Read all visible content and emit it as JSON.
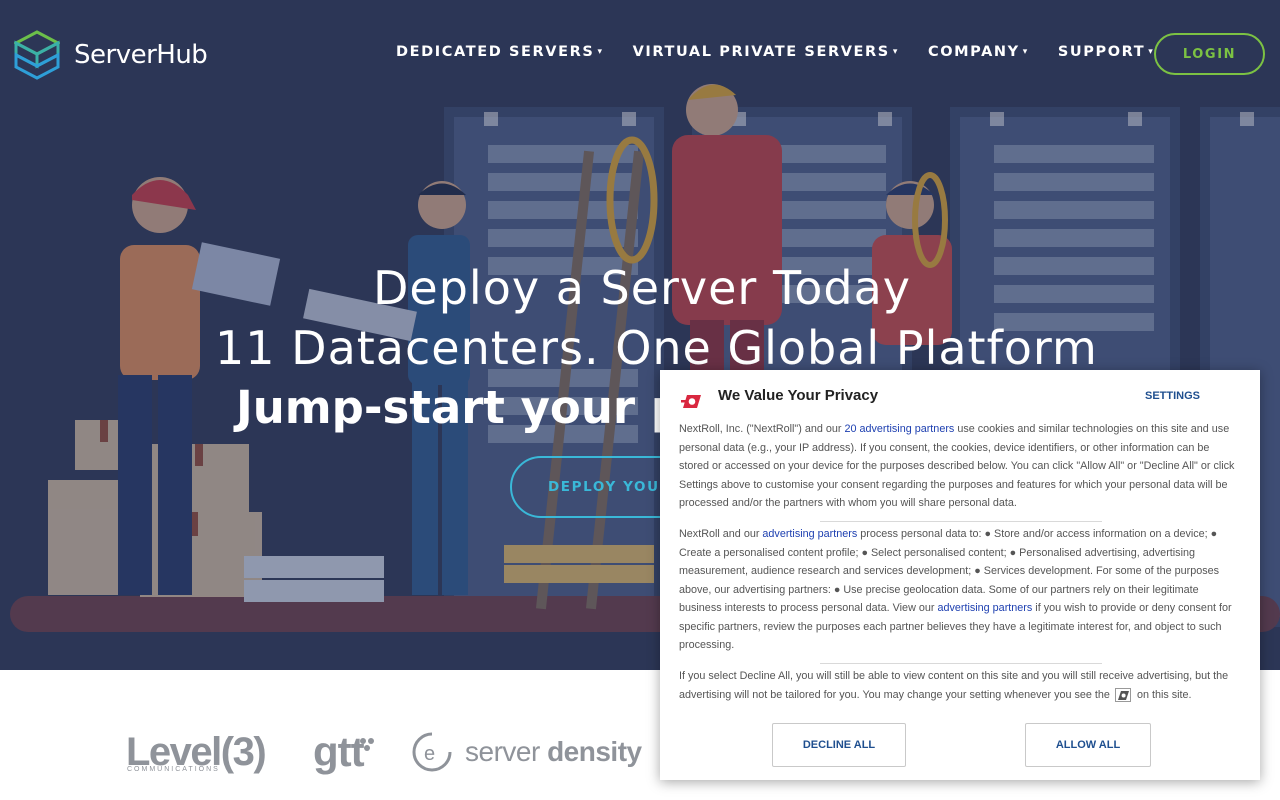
{
  "brand": {
    "name": "ServerHub"
  },
  "nav": {
    "items": [
      {
        "label": "DEDICATED SERVERS"
      },
      {
        "label": "VIRTUAL PRIVATE SERVERS"
      },
      {
        "label": "COMPANY"
      },
      {
        "label": "SUPPORT"
      }
    ],
    "caret": "▾",
    "login_label": "LOGIN"
  },
  "hero": {
    "line1": "Deploy a Server Today",
    "line2": "11 Datacenters. One Global Platform",
    "line3": "Jump-start your p",
    "cta_label": "DEPLOY YOUR"
  },
  "partners": {
    "level3": "Level(3)",
    "level3_sub": "COMMUNICATIONS",
    "gtt": "gtt",
    "serverdensity_light": "server",
    "serverdensity_bold": "density"
  },
  "cookie": {
    "title": "We Value Your Privacy",
    "settings_label": "SETTINGS",
    "p1_a": "NextRoll, Inc. (\"NextRoll\") and our ",
    "p1_link": "20 advertising partners",
    "p1_b": " use cookies and similar technologies on this site and use personal data (e.g., your IP address). If you consent, the cookies, device identifiers, or other information can be stored or accessed on your device for the purposes described below. You can click \"Allow All\" or \"Decline All\" or click Settings above to customise your consent regarding the purposes and features for which your personal data will be processed and/or the partners with whom you will share personal data.",
    "p2_a": "NextRoll and our ",
    "p2_link1": "advertising partners",
    "p2_b": " process personal data to: ● Store and/or access information on a device; ● Create a personalised content profile; ● Select personalised content; ● Personalised advertising, advertising measurement, audience research and services development; ● Services development. For some of the purposes above, our advertising partners: ● Use precise geolocation data. Some of our partners rely on their legitimate business interests to process personal data. View our ",
    "p2_link2": "advertising partners",
    "p2_c": " if you wish to provide or deny consent for specific partners, review the purposes each partner believes they have a legitimate interest for, and object to such processing.",
    "p3_a": "If you select Decline All, you will still be able to view content on this site and you will still receive advertising, but the advertising will not be tailored for you. You may change your setting whenever you see the",
    "p3_b": "on this site.",
    "decline_label": "DECLINE ALL",
    "allow_label": "ALLOW ALL"
  },
  "colors": {
    "hero_bg": "#2f3a5a",
    "login_accent": "#7cc243",
    "cta_accent": "#3ab8d8",
    "link_blue": "#1d3fb0"
  }
}
